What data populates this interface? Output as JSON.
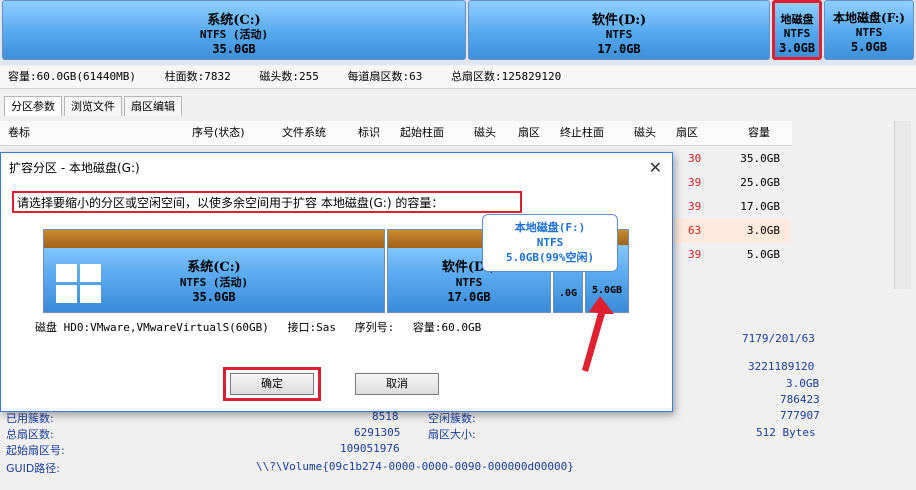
{
  "partitions_top": [
    {
      "name": "系统(C:)",
      "fs": "NTFS (活动)",
      "size": "35.0GB"
    },
    {
      "name": "软件(D:)",
      "fs": "NTFS",
      "size": "17.0GB"
    },
    {
      "name": "地磁盘",
      "fs": "NTFS",
      "size": "3.0GB"
    },
    {
      "name": "本地磁盘(F:)",
      "fs": "NTFS",
      "size": "5.0GB"
    }
  ],
  "disk_info_line": [
    "容量:60.0GB(61440MB)",
    "柱面数:7832",
    "磁头数:255",
    "每道扇区数:63",
    "总扇区数:125829120"
  ],
  "tabs": [
    "分区参数",
    "浏览文件",
    "扇区编辑"
  ],
  "table_headers": [
    "卷标",
    "序号(状态)",
    "文件系统",
    "标识",
    "起始柱面",
    "磁头",
    "扇区",
    "终止柱面",
    "磁头",
    "扇区",
    "容量"
  ],
  "table_rows": [
    {
      "sector": "30",
      "capacity": "35.0GB"
    },
    {
      "sector": "39",
      "capacity": "25.0GB"
    },
    {
      "sector": "39",
      "capacity": "17.0GB"
    },
    {
      "sector": "63",
      "capacity": "3.0GB"
    },
    {
      "sector": "39",
      "capacity": "5.0GB"
    }
  ],
  "lower_panel": {
    "chs": "7179/201/63",
    "total_bytes": "3221189120",
    "size": "3.0GB",
    "v1": "786423",
    "v2": "777907",
    "sector_size": "512 Bytes",
    "used_clusters_label": "已用簇数:",
    "used_clusters": "8518",
    "free_clusters_label": "空闲簇数:",
    "total_sectors_label": "总扇区数:",
    "total_sectors": "6291305",
    "sector_size_label": "扇区大小:",
    "start_sector_label": "起始扇区号:",
    "start_sector": "109051976",
    "guid_label": "GUID路径:",
    "guid": "\\\\?\\Volume{09c1b274-0000-0000-0090-000000d00000}"
  },
  "dialog": {
    "title": "扩容分区 - 本地磁盘(G:)",
    "close": "✕",
    "instruction": "请选择要缩小的分区或空闲空间，以使多余空间用于扩容 本地磁盘(G:) 的容量：",
    "map": [
      {
        "name": "系统(C:)",
        "fs": "NTFS (活动)",
        "size": "35.0GB"
      },
      {
        "name": "软件(D:)",
        "fs": "NTFS",
        "size": "17.0GB"
      },
      {
        "name": "",
        "fs": "",
        "size": ".0G"
      },
      {
        "name": "",
        "fs": "",
        "size": "5.0GB"
      }
    ],
    "disk_label": "磁盘 HD0:VMware,VMwareVirtualS(60GB)",
    "iface_label": "接口:Sas",
    "serial_label": "序列号:",
    "capacity_label": "容量:60.0GB",
    "ok": "确定",
    "cancel": "取消"
  },
  "tooltip": {
    "line1": "本地磁盘(F:)",
    "line2": "NTFS",
    "line3": "5.0GB(99%空闲)"
  },
  "colors": {
    "accent_red": "#e02030",
    "partition_blue": "#56a8ee",
    "dialog_border": "#3c7bd5"
  }
}
